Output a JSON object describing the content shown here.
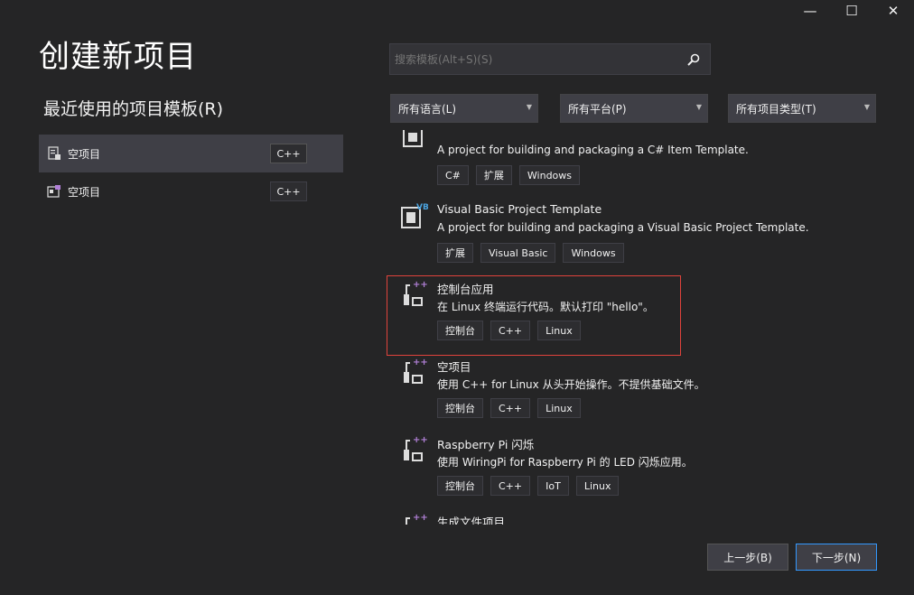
{
  "window": {
    "minimize": "—",
    "maximize": "☐",
    "close": "✕"
  },
  "page_title": "创建新项目",
  "recent": {
    "title": "最近使用的项目模板(R)",
    "items": [
      {
        "label": "空项目",
        "tag": "C++",
        "icon": "empty-project-icon",
        "selected": true
      },
      {
        "label": "空项目",
        "tag": "C++",
        "icon": "empty-project-cpp-icon",
        "selected": false
      }
    ]
  },
  "search": {
    "placeholder": "搜索模板(Alt+S)(S)",
    "icon": "search-icon"
  },
  "filters": {
    "language": "所有语言(L)",
    "platform": "所有平台(P)",
    "project_type": "所有项目类型(T)"
  },
  "templates": [
    {
      "name": "",
      "description": "A project for building and packaging a C# Item Template.",
      "tags": [
        "C#",
        "扩展",
        "Windows"
      ],
      "icon": "csharp-item-template-icon",
      "badge": ""
    },
    {
      "name": "Visual Basic Project Template",
      "description": "A project for building and packaging a Visual Basic Project Template.",
      "tags": [
        "扩展",
        "Visual Basic",
        "Windows"
      ],
      "icon": "vb-project-template-icon",
      "badge": "VB"
    },
    {
      "name": "控制台应用",
      "description": "在 Linux 终端运行代码。默认打印 \"hello\"。",
      "tags": [
        "控制台",
        "C++",
        "Linux"
      ],
      "icon": "cpp-console-app-icon",
      "badge": "++"
    },
    {
      "name": "空项目",
      "description": "使用 C++ for Linux 从头开始操作。不提供基础文件。",
      "tags": [
        "控制台",
        "C++",
        "Linux"
      ],
      "icon": "cpp-empty-project-icon",
      "badge": "++"
    },
    {
      "name": "Raspberry Pi 闪烁",
      "description": "使用 WiringPi for Raspberry Pi 的 LED 闪烁应用。",
      "tags": [
        "控制台",
        "C++",
        "IoT",
        "Linux"
      ],
      "icon": "raspberry-pi-icon",
      "badge": "++"
    },
    {
      "name": "生成文件项目",
      "description": "",
      "tags": [],
      "icon": "makefile-project-icon",
      "badge": "++"
    }
  ],
  "buttons": {
    "back": "上一步(B)",
    "next": "下一步(N)"
  },
  "colors": {
    "background": "#252526",
    "selected": "#3f3f46",
    "highlight_border": "#e0433c",
    "primary_border": "#3399ff",
    "cpp_badge": "#b180d7",
    "vb_badge": "#4aa3df"
  }
}
